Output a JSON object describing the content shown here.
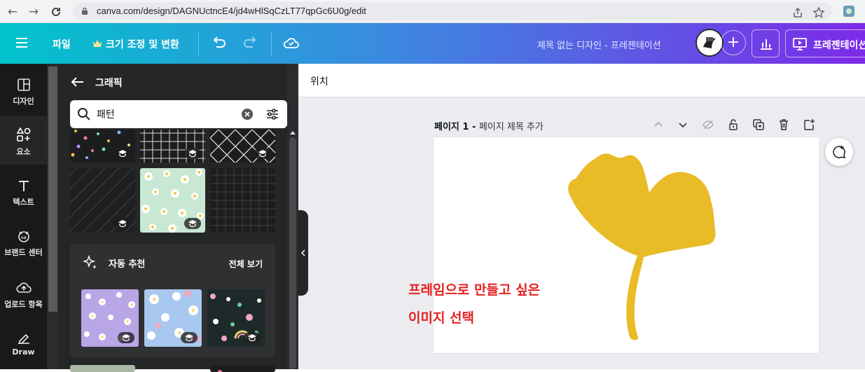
{
  "browser": {
    "url": "canva.com/design/DAGNUctncE4/jd4wHlSqCzLT77qpGc6U0g/edit",
    "icons": [
      "back-arrow-icon",
      "forward-arrow-icon",
      "reload-icon",
      "lock-icon",
      "share-icon",
      "star-icon",
      "extension-icon"
    ]
  },
  "topbar": {
    "file_label": "파일",
    "resize_label": "크기 조정 및 변환",
    "design_title": "제목 없는 디자인 - 프레젠테이션",
    "present_label": "프레젠테이션",
    "colors": {
      "gradient_start": "#00c4cc",
      "gradient_mid": "#3c89e0",
      "gradient_end": "#7d2ae8"
    }
  },
  "rail": {
    "items": [
      {
        "label": "디자인",
        "icon": "layout-icon"
      },
      {
        "label": "요소",
        "icon": "shapes-icon"
      },
      {
        "label": "텍스트",
        "icon": "text-icon"
      },
      {
        "label": "브랜드 센터",
        "icon": "brand-icon"
      },
      {
        "label": "업로드 항목",
        "icon": "upload-cloud-icon"
      },
      {
        "label": "Draw",
        "icon": "draw-icon"
      }
    ],
    "active": "요소"
  },
  "panel": {
    "header": "그래픽",
    "search_value": "패턴",
    "recommend_title": "자동 추천",
    "recommend_all": "전체 보기"
  },
  "main": {
    "position_label": "위치",
    "page_label_prefix": "페이지 1 - ",
    "page_title_placeholder": "페이지 제목 추가",
    "annotation_line1": "프레임으로 만들고 싶은",
    "annotation_line2": "이미지 선택",
    "annotation_color": "#e62020",
    "leaf_color": "#e8bb27"
  }
}
